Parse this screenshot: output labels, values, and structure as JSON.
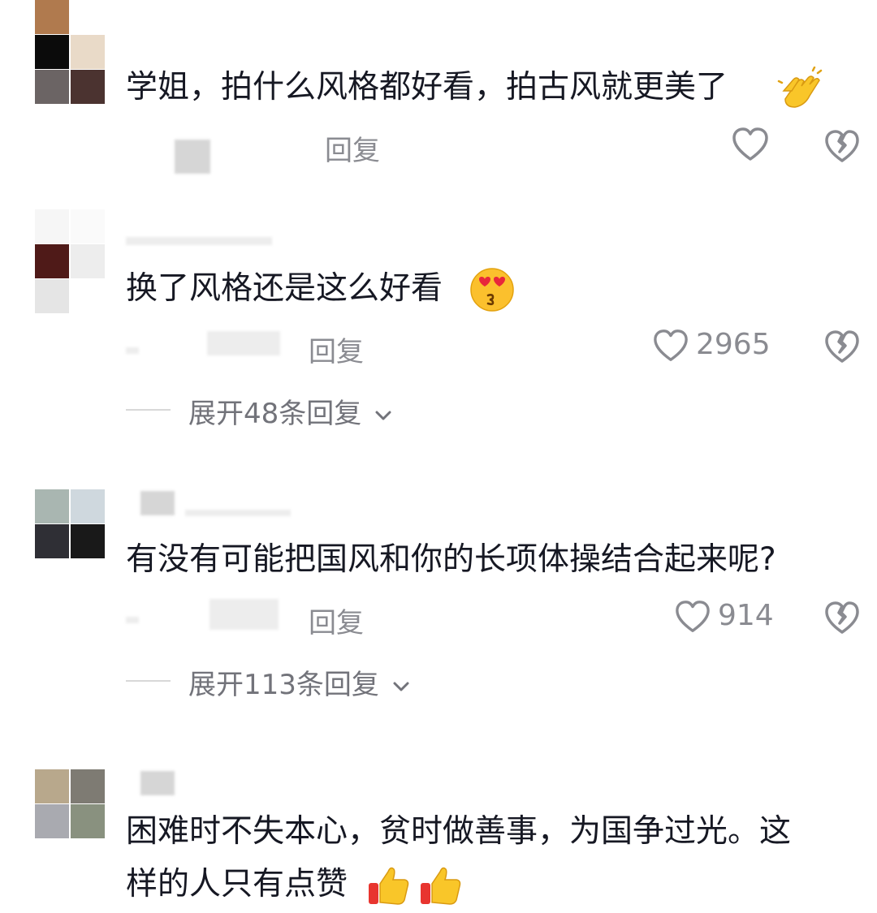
{
  "comments": [
    {
      "text": "学姐，拍什么风格都好看，拍古风就更美了",
      "reply_label": "回复",
      "like_count": "",
      "emojis": [
        "clap-emoji"
      ],
      "expand": ""
    },
    {
      "text": "换了风格还是这么好看",
      "reply_label": "回复",
      "like_count": "2965",
      "emojis": [
        "heart-eyes-emoji"
      ],
      "expand": "展开48条回复"
    },
    {
      "text": "有没有可能把国风和你的长项体操结合起来呢?",
      "reply_label": "回复",
      "like_count": "914",
      "emojis": [],
      "expand": "展开113条回复"
    },
    {
      "text_line1": "困难时不失本心，贫时做善事，为国争过光。这",
      "text_line2": "样的人只有点赞",
      "emojis": [
        "thumbs-up-emoji",
        "thumbs-up-emoji"
      ]
    }
  ],
  "icons": {
    "like": "heart-outline-icon",
    "dislike": "broken-heart-icon",
    "expand_chevron": "chevron-down-icon"
  },
  "colors": {
    "text": "#161823",
    "secondary": "#8a8b91",
    "icon": "#8a8b91"
  }
}
